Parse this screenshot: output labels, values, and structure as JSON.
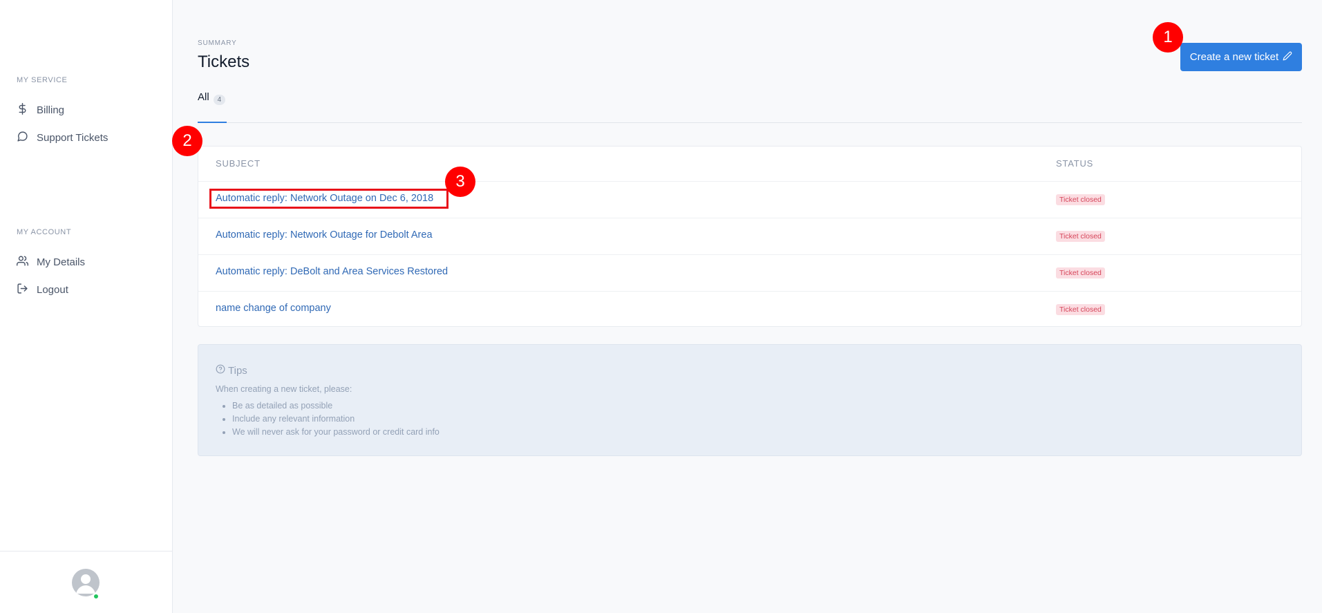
{
  "sidebar": {
    "my_service_label": "MY SERVICE",
    "my_account_label": "MY ACCOUNT",
    "items": [
      {
        "label": "Billing",
        "icon": "dollar-icon"
      },
      {
        "label": "Support Tickets",
        "icon": "chat-bubble-icon"
      },
      {
        "label": "My Details",
        "icon": "users-icon"
      },
      {
        "label": "Logout",
        "icon": "logout-icon"
      }
    ],
    "status_color": "#22c55e"
  },
  "header": {
    "eyebrow": "SUMMARY",
    "title": "Tickets",
    "create_button_label": "Create a new ticket",
    "create_button_icon": "pencil-icon"
  },
  "tabs": [
    {
      "label": "All",
      "count": "4"
    }
  ],
  "table": {
    "columns": [
      "SUBJECT",
      "STATUS"
    ],
    "rows": [
      {
        "subject": "Automatic reply: Network Outage on Dec 6, 2018",
        "status": "Ticket closed"
      },
      {
        "subject": "Automatic reply: Network Outage for Debolt Area",
        "status": "Ticket closed"
      },
      {
        "subject": "Automatic reply: DeBolt and Area Services Restored",
        "status": "Ticket closed"
      },
      {
        "subject": "name change of company",
        "status": "Ticket closed"
      }
    ]
  },
  "tips": {
    "title": "Tips",
    "intro": "When creating a new ticket, please:",
    "items": [
      "Be as detailed as possible",
      "Include any relevant information",
      "We will never ask for your password or credit card info"
    ]
  },
  "annotations": {
    "markers": [
      "1",
      "2",
      "3"
    ],
    "color": "#ff0000"
  },
  "colors": {
    "accent": "#2f7fe0",
    "link": "#3069b5",
    "status_closed_text": "#d6455a",
    "status_closed_bg": "#fbdde2"
  }
}
